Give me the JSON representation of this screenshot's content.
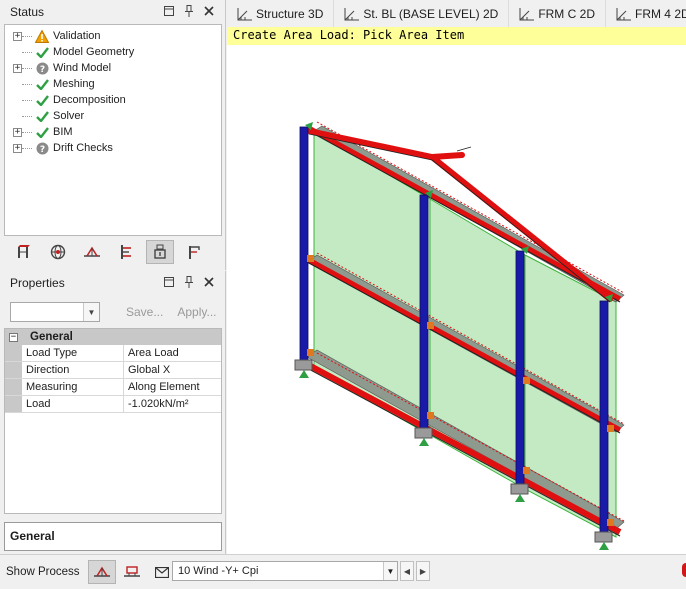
{
  "status_panel": {
    "title": "Status",
    "items": [
      {
        "label": "Validation",
        "icon": "warning-icon",
        "expandable": true
      },
      {
        "label": "Model Geometry",
        "icon": "check-icon",
        "expandable": false
      },
      {
        "label": "Wind Model",
        "icon": "question-icon",
        "expandable": true
      },
      {
        "label": "Meshing",
        "icon": "check-icon",
        "expandable": false
      },
      {
        "label": "Decomposition",
        "icon": "check-icon",
        "expandable": false
      },
      {
        "label": "Solver",
        "icon": "check-icon",
        "expandable": false
      },
      {
        "label": "BIM",
        "icon": "check-icon",
        "expandable": true
      },
      {
        "label": "Drift Checks",
        "icon": "question-icon",
        "expandable": true
      }
    ]
  },
  "properties_panel": {
    "title": "Properties",
    "save_label": "Save...",
    "apply_label": "Apply...",
    "category": "General",
    "rows": [
      {
        "key": "Load Type",
        "value": "Area Load"
      },
      {
        "key": "Direction",
        "value": "Global X"
      },
      {
        "key": "Measuring",
        "value": "Along Element"
      },
      {
        "key": "Load",
        "value": "-1.020kN/m²"
      }
    ],
    "description_title": "General"
  },
  "tabs": [
    {
      "label": "Structure 3D"
    },
    {
      "label": "St. BL (BASE LEVEL) 2D"
    },
    {
      "label": "FRM C 2D"
    },
    {
      "label": "FRM 4 2D"
    }
  ],
  "viewport": {
    "prompt": "Create Area Load: Pick Area Item"
  },
  "bottom_bar": {
    "show_process_label": "Show Process",
    "load_case": "10 Wind -Y+ Cpi"
  },
  "colors": {
    "column": "#1a1aa8",
    "beam": "#e01010",
    "panel": "#9bdc9b",
    "prompt_bg": "#ffff99",
    "check": "#2ea043",
    "warning": "#f0a000"
  }
}
